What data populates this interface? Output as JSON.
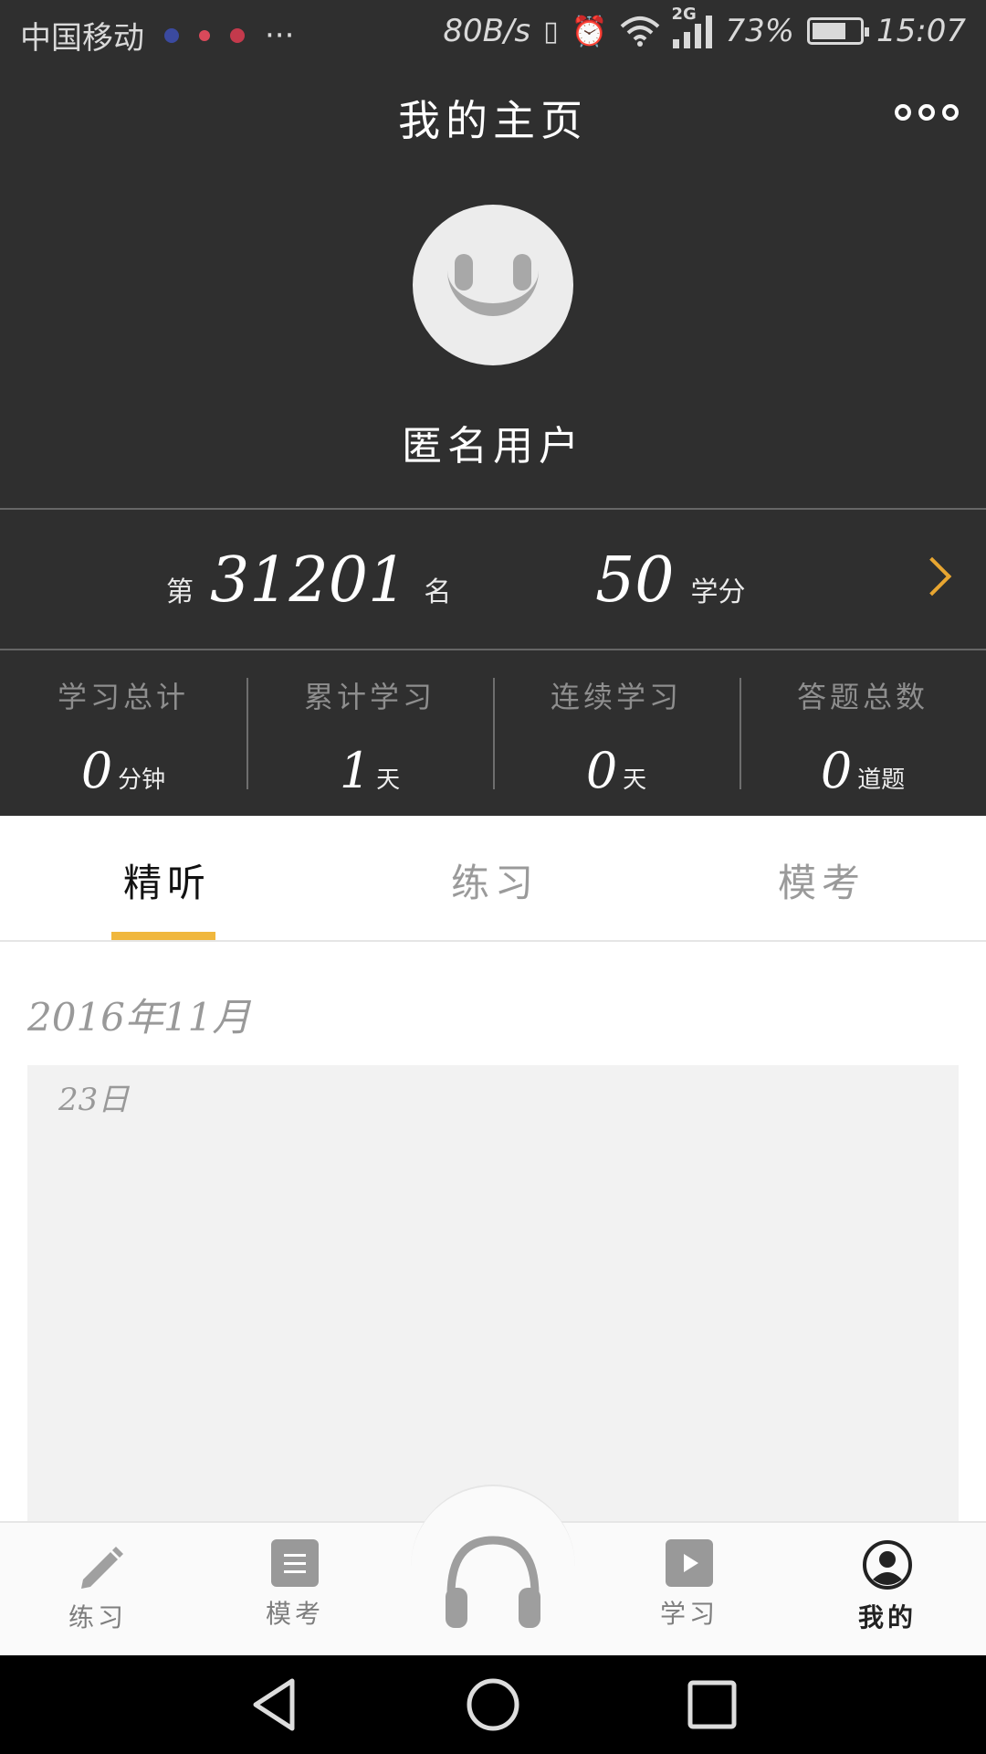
{
  "status_bar": {
    "carrier": "中国移动",
    "more": "···",
    "speed": "80B/s",
    "network": "2G",
    "battery": "73%",
    "time": "15:07"
  },
  "header": {
    "title": "我的主页"
  },
  "profile": {
    "username": "匿名用户"
  },
  "rank": {
    "prefix": "第",
    "position": "31201",
    "suffix": "名",
    "credits": "50",
    "credits_unit": "学分"
  },
  "stats": [
    {
      "label": "学习总计",
      "value": "0",
      "unit": "分钟"
    },
    {
      "label": "累计学习",
      "value": "1",
      "unit": "天"
    },
    {
      "label": "连续学习",
      "value": "0",
      "unit": "天"
    },
    {
      "label": "答题总数",
      "value": "0",
      "unit": "道题"
    }
  ],
  "tabs": [
    {
      "label": "精听",
      "active": true
    },
    {
      "label": "练习",
      "active": false
    },
    {
      "label": "模考",
      "active": false
    }
  ],
  "history": {
    "month": "2016年11月",
    "day": "23日"
  },
  "bottom_nav": [
    {
      "label": "练习",
      "icon": "pencil-icon"
    },
    {
      "label": "模考",
      "icon": "list-icon"
    },
    {
      "label": "",
      "icon": "headphones-icon"
    },
    {
      "label": "学习",
      "icon": "play-icon"
    },
    {
      "label": "我的",
      "icon": "user-icon",
      "active": true
    }
  ],
  "colors": {
    "header_bg": "#2f2f2f",
    "accent": "#f0b73d",
    "chevron": "#e8a631"
  }
}
